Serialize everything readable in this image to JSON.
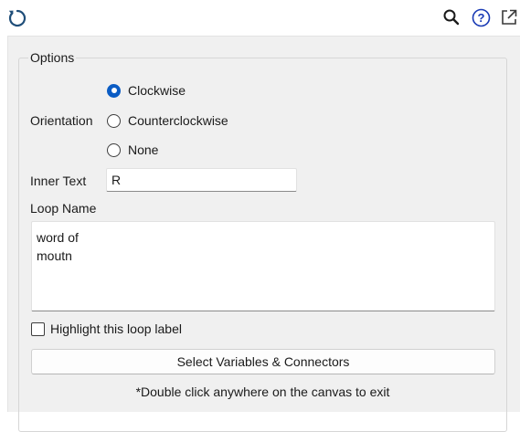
{
  "toolbar": {
    "refresh_icon": "refresh-icon",
    "search_icon": "search-icon",
    "help_icon": "help-icon",
    "popout_icon": "external-window-icon",
    "accent_color": "#0b5cc4"
  },
  "options": {
    "legend": "Options",
    "orientation_label": "Orientation",
    "orientation_options": [
      {
        "label": "Clockwise",
        "checked": true
      },
      {
        "label": "Counterclockwise",
        "checked": false
      },
      {
        "label": "None",
        "checked": false
      }
    ],
    "inner_text_label": "Inner Text",
    "inner_text_value": "R",
    "loop_name_label": "Loop Name",
    "loop_name_value": "word of\nmoutn",
    "highlight_label": "Highlight this loop label",
    "highlight_checked": false,
    "select_button_label": "Select Variables & Connectors",
    "hint_text": "*Double click anywhere on the canvas to exit"
  }
}
